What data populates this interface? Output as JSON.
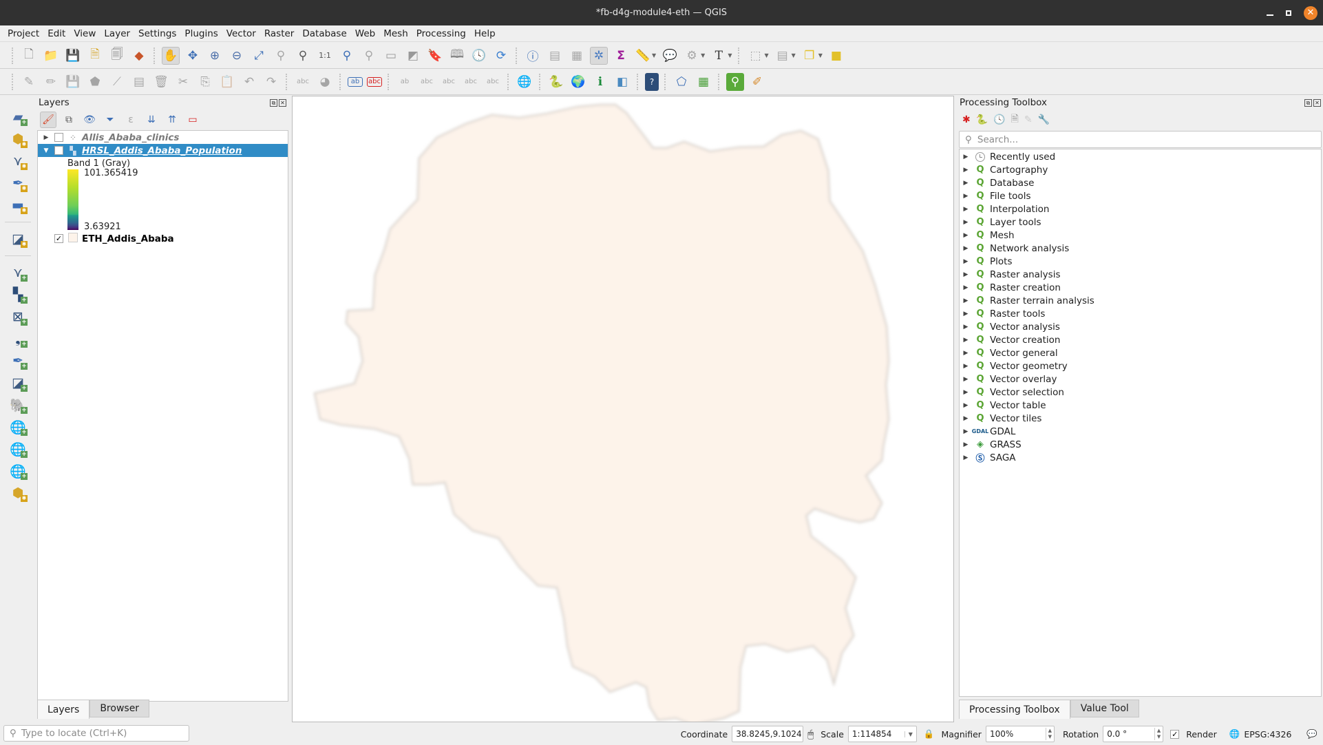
{
  "window": {
    "title": "*fb-d4g-module4-eth — QGIS",
    "controls": [
      "minimize-icon",
      "maximize-icon",
      "close-icon"
    ]
  },
  "menubar": {
    "items": [
      "Project",
      "Edit",
      "View",
      "Layer",
      "Settings",
      "Plugins",
      "Vector",
      "Raster",
      "Database",
      "Web",
      "Mesh",
      "Processing",
      "Help"
    ]
  },
  "toolbar1": {
    "icons": [
      "new-project-icon",
      "open-project-icon",
      "save-project-icon",
      "new-print-layout-icon",
      "layout-manager-icon",
      "style-manager-icon",
      "pan-icon",
      "pan-to-selection-icon",
      "zoom-in-icon",
      "zoom-out-icon",
      "zoom-full-icon",
      "zoom-to-selection-icon",
      "zoom-to-layer-icon",
      "zoom-native-icon",
      "zoom-last-icon",
      "zoom-next-icon",
      "new-map-view-icon",
      "new-3d-map-view-icon",
      "new-bookmark-icon",
      "show-bookmarks-icon",
      "temporal-controller-icon",
      "refresh-icon",
      "identify-icon",
      "attribute-table-icon",
      "field-calculator-icon",
      "processing-toolbox-icon",
      "statistical-summary-icon",
      "measure-icon",
      "map-tips-icon",
      "feature-action-icon",
      "text-annotation-icon",
      "select-features-icon",
      "deselect-icon",
      "deselect-all-icon",
      "annotation-marker-icon"
    ]
  },
  "toolbar2": {
    "icons": [
      "current-edits-icon",
      "toggle-editing-icon",
      "save-edits-icon",
      "add-polygon-icon",
      "digitize-icon",
      "modify-attributes-icon",
      "delete-selected-icon",
      "cut-features-icon",
      "copy-features-icon",
      "paste-features-icon",
      "undo-icon",
      "redo-icon",
      "label-tool-icon",
      "diagram-tool-icon",
      "layer-labeling-icon",
      "layer-labeling-red-icon",
      "pin-labels-icon",
      "show-hide-labels-icon",
      "move-label-icon",
      "rotate-label-icon",
      "change-label-icon",
      "osm-search-icon",
      "python-console-icon",
      "globe-icon",
      "value-tool-icon",
      "split-view-icon",
      "help-icon",
      "geometry-checker-icon",
      "refresh-table-icon",
      "search-plugin-icon",
      "qgis2web-icon"
    ]
  },
  "left_toolbar": {
    "icons": [
      "data-source-manager-icon",
      "new-geopackage-layer-icon",
      "new-shapefile-layer-icon",
      "new-temporary-scratch-layer-icon",
      "new-virtual-layer-icon",
      "new-mesh-layer-icon",
      "add-vector-layer-icon",
      "add-raster-layer-icon",
      "add-mesh-layer-icon",
      "add-delimited-text-icon",
      "add-spatialite-icon",
      "add-virtual-layer-icon",
      "add-postgis-icon",
      "add-wms-icon",
      "add-wfs-icon",
      "add-wcs-icon",
      "add-geonode-icon"
    ]
  },
  "layers_panel": {
    "title": "Layers",
    "toolbar": [
      "open-layer-styling-icon",
      "add-group-icon",
      "manage-visibility-icon",
      "filter-legend-icon",
      "filter-expression-icon",
      "expand-all-icon",
      "collapse-all-icon",
      "remove-layer-icon"
    ],
    "layers": [
      {
        "name": "Allis_Ababa_clinics",
        "checked": false,
        "expanded": false,
        "type": "point",
        "selected": false
      },
      {
        "name": "HRSL_Addis_Ababa_Population",
        "checked": false,
        "expanded": true,
        "type": "raster",
        "selected": true,
        "legend": {
          "band": "Band 1 (Gray)",
          "max": "101.365419",
          "min": "3.63921"
        }
      },
      {
        "name": "ETH_Addis_Ababa",
        "checked": true,
        "expanded": false,
        "type": "polygon",
        "selected": false,
        "fill": "#fdf3ea"
      }
    ],
    "tabs": [
      "Layers",
      "Browser"
    ],
    "active_tab": "Layers"
  },
  "map": {
    "polygon_fill": "#fdf3ea",
    "polygon_stroke": "#d9d3cd",
    "background": "#ffffff"
  },
  "processing_toolbox": {
    "title": "Processing Toolbox",
    "toolbar": [
      "models-icon",
      "scripts-icon",
      "history-icon",
      "results-viewer-icon",
      "edit-features-in-place-icon",
      "options-icon"
    ],
    "search_placeholder": "Search...",
    "groups": [
      {
        "label": "Recently used",
        "icon": "clock-icon"
      },
      {
        "label": "Cartography",
        "icon": "qgis-icon"
      },
      {
        "label": "Database",
        "icon": "qgis-icon"
      },
      {
        "label": "File tools",
        "icon": "qgis-icon"
      },
      {
        "label": "Interpolation",
        "icon": "qgis-icon"
      },
      {
        "label": "Layer tools",
        "icon": "qgis-icon"
      },
      {
        "label": "Mesh",
        "icon": "qgis-icon"
      },
      {
        "label": "Network analysis",
        "icon": "qgis-icon"
      },
      {
        "label": "Plots",
        "icon": "qgis-icon"
      },
      {
        "label": "Raster analysis",
        "icon": "qgis-icon"
      },
      {
        "label": "Raster creation",
        "icon": "qgis-icon"
      },
      {
        "label": "Raster terrain analysis",
        "icon": "qgis-icon"
      },
      {
        "label": "Raster tools",
        "icon": "qgis-icon"
      },
      {
        "label": "Vector analysis",
        "icon": "qgis-icon"
      },
      {
        "label": "Vector creation",
        "icon": "qgis-icon"
      },
      {
        "label": "Vector general",
        "icon": "qgis-icon"
      },
      {
        "label": "Vector geometry",
        "icon": "qgis-icon"
      },
      {
        "label": "Vector overlay",
        "icon": "qgis-icon"
      },
      {
        "label": "Vector selection",
        "icon": "qgis-icon"
      },
      {
        "label": "Vector table",
        "icon": "qgis-icon"
      },
      {
        "label": "Vector tiles",
        "icon": "qgis-icon"
      },
      {
        "label": "GDAL",
        "icon": "gdal-icon"
      },
      {
        "label": "GRASS",
        "icon": "grass-icon"
      },
      {
        "label": "SAGA",
        "icon": "saga-icon"
      }
    ],
    "tabs": [
      "Processing Toolbox",
      "Value Tool"
    ],
    "active_tab": "Processing Toolbox"
  },
  "statusbar": {
    "locator_placeholder": "Type to locate (Ctrl+K)",
    "coordinate_label": "Coordinate",
    "coordinate_value": "38.8245,9.1024",
    "scale_label": "Scale",
    "scale_value": "1:114854",
    "magnifier_label": "Magnifier",
    "magnifier_value": "100%",
    "rotation_label": "Rotation",
    "rotation_value": "0.0 °",
    "render_label": "Render",
    "render_checked": true,
    "crs": "EPSG:4326"
  }
}
